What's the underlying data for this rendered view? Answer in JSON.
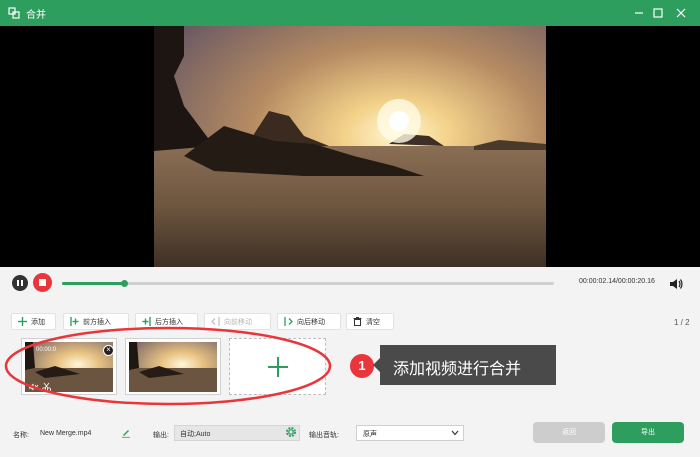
{
  "window": {
    "title": "合并"
  },
  "colors": {
    "accent": "#2e9e5e",
    "stop": "#e8363b",
    "annotation": "#e8363b"
  },
  "icons": {
    "app": "merge-icon",
    "minimize": "minimize-icon",
    "maximize": "maximize-icon",
    "close": "close-icon",
    "volume": "volume-icon",
    "pause": "pause-icon",
    "stop": "stop-icon"
  },
  "playback": {
    "time": "00:00:02.14/00:00:20.16",
    "progress": 0.125
  },
  "toolbar": {
    "add": "添加",
    "insert_before": "前方插入",
    "insert_after": "后方插入",
    "move_forward": "向前移动",
    "move_backward": "向后移动",
    "clear": "清空",
    "page": "1 / 2"
  },
  "clips": [
    {
      "duration": "00:00:0"
    },
    {
      "duration": ""
    }
  ],
  "annotation": {
    "number": "1",
    "text": "添加视频进行合并"
  },
  "footer": {
    "name_label": "名称:",
    "name_value": "New Merge.mp4",
    "output_label": "输出:",
    "output_value": "自动;Auto",
    "audio_label": "输出音轨:",
    "audio_value": "原声",
    "back": "返回",
    "export": "导出"
  }
}
